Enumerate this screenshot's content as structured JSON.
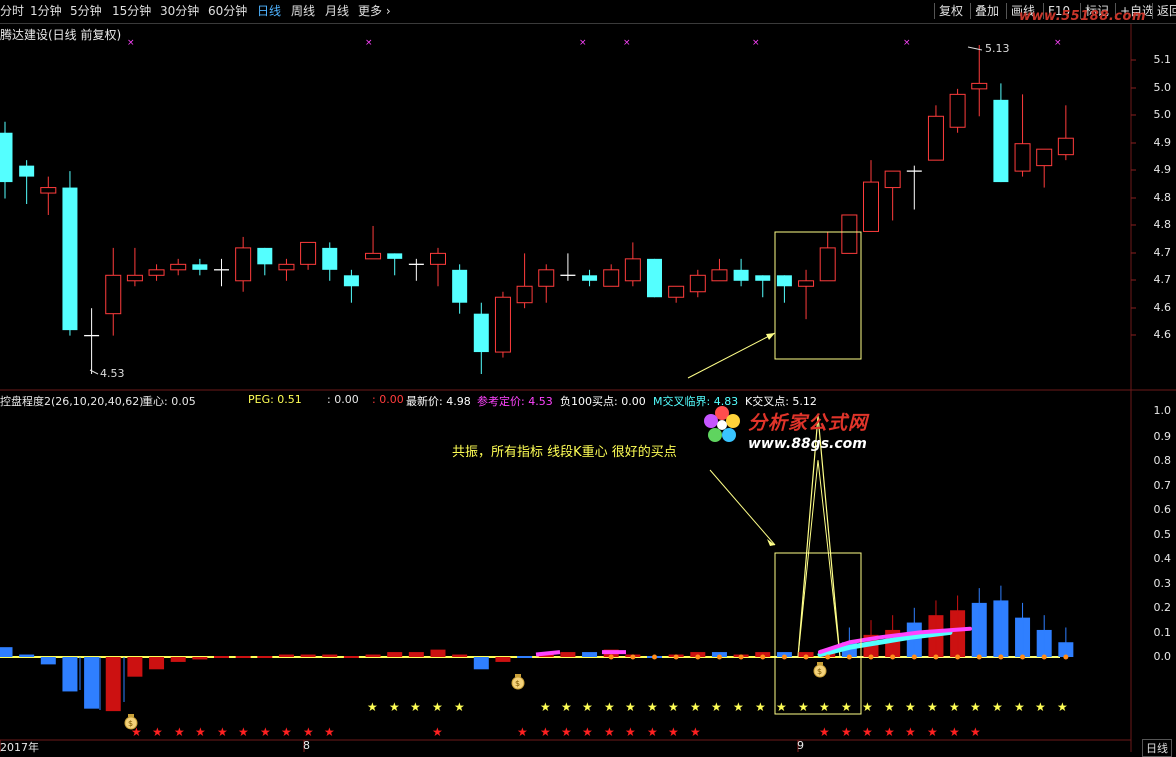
{
  "toolbar": {
    "tabs": [
      {
        "label": "分时",
        "x": 0
      },
      {
        "label": "1分钟",
        "x": 30
      },
      {
        "label": "5分钟",
        "x": 70
      },
      {
        "label": "15分钟",
        "x": 112
      },
      {
        "label": "30分钟",
        "x": 160
      },
      {
        "label": "60分钟",
        "x": 208
      },
      {
        "label": "日线",
        "x": 257,
        "active": true
      },
      {
        "label": "周线",
        "x": 291
      },
      {
        "label": "月线",
        "x": 325
      },
      {
        "label": "更多 ›",
        "x": 358
      }
    ],
    "right": [
      {
        "label": "复权",
        "x": 934
      },
      {
        "label": "叠加",
        "x": 970
      },
      {
        "label": "画线",
        "x": 1006
      },
      {
        "label": "F10",
        "x": 1043
      },
      {
        "label": "标记",
        "x": 1080
      },
      {
        "label": "+自选",
        "x": 1115
      },
      {
        "label": "返回",
        "x": 1152
      }
    ],
    "watermark": "www.55188.com"
  },
  "stock_title": "腾达建设(日线 前复权)",
  "price_axis": [
    "5.1",
    "5.0",
    "5.0",
    "4.9",
    "4.9",
    "4.8",
    "4.8",
    "4.7",
    "4.7",
    "4.6",
    "4.6"
  ],
  "max_label": "5.13",
  "min_label": "4.53",
  "indicator": {
    "name": "控盘程度2(26,10,20,40,62)",
    "zhongxin": "重心: 0.05",
    "peg": "PEG: 0.51",
    "blank": ": 0.00",
    "red": ": 0.00",
    "zuixin": "最新价: 4.98",
    "cankao": "参考定价: 4.53",
    "fu100": "负100买点: 0.00",
    "mjiao": "M交叉临界: 4.83",
    "kjiao": "K交叉点: 5.12",
    "axis": [
      "1.0",
      "0.9",
      "0.8",
      "0.7",
      "0.6",
      "0.5",
      "0.4",
      "0.3",
      "0.2",
      "0.1",
      "0.0"
    ]
  },
  "annotation": "共振，所有指标 线段K重心 很好的买点",
  "logo": {
    "text": "分析家公式网",
    "sub": "www.88gs.com"
  },
  "x_axis": [
    {
      "label": "2017年",
      "x": 0
    },
    {
      "label": "8",
      "x": 303
    },
    {
      "label": "9",
      "x": 797
    }
  ],
  "bottom_right": "日线",
  "colors": {
    "up": "#ff3c3c",
    "down": "#54ffff",
    "yellow": "#ffff55",
    "magenta": "#ff44ff"
  },
  "chart_data": {
    "type": "candlestick",
    "series": [
      {
        "o": 4.97,
        "h": 4.99,
        "l": 4.85,
        "c": 4.88
      },
      {
        "o": 4.91,
        "h": 4.92,
        "l": 4.84,
        "c": 4.89
      },
      {
        "o": 4.86,
        "h": 4.89,
        "l": 4.82,
        "c": 4.87
      },
      {
        "o": 4.87,
        "h": 4.9,
        "l": 4.6,
        "c": 4.61
      },
      {
        "o": 4.6,
        "h": 4.65,
        "l": 4.53,
        "c": 4.6
      },
      {
        "o": 4.64,
        "h": 4.76,
        "l": 4.6,
        "c": 4.71
      },
      {
        "o": 4.7,
        "h": 4.76,
        "l": 4.69,
        "c": 4.71
      },
      {
        "o": 4.71,
        "h": 4.73,
        "l": 4.7,
        "c": 4.72
      },
      {
        "o": 4.72,
        "h": 4.74,
        "l": 4.71,
        "c": 4.73
      },
      {
        "o": 4.73,
        "h": 4.74,
        "l": 4.71,
        "c": 4.72
      },
      {
        "o": 4.72,
        "h": 4.74,
        "l": 4.69,
        "c": 4.72
      },
      {
        "o": 4.7,
        "h": 4.78,
        "l": 4.68,
        "c": 4.76
      },
      {
        "o": 4.76,
        "h": 4.76,
        "l": 4.71,
        "c": 4.73
      },
      {
        "o": 4.72,
        "h": 4.74,
        "l": 4.7,
        "c": 4.73
      },
      {
        "o": 4.73,
        "h": 4.77,
        "l": 4.72,
        "c": 4.77
      },
      {
        "o": 4.76,
        "h": 4.77,
        "l": 4.7,
        "c": 4.72
      },
      {
        "o": 4.71,
        "h": 4.72,
        "l": 4.66,
        "c": 4.69
      },
      {
        "o": 4.74,
        "h": 4.8,
        "l": 4.74,
        "c": 4.75
      },
      {
        "o": 4.75,
        "h": 4.75,
        "l": 4.71,
        "c": 4.74
      },
      {
        "o": 4.73,
        "h": 4.74,
        "l": 4.7,
        "c": 4.73
      },
      {
        "o": 4.73,
        "h": 4.76,
        "l": 4.69,
        "c": 4.75
      },
      {
        "o": 4.72,
        "h": 4.73,
        "l": 4.64,
        "c": 4.66
      },
      {
        "o": 4.64,
        "h": 4.66,
        "l": 4.53,
        "c": 4.57
      },
      {
        "o": 4.57,
        "h": 4.68,
        "l": 4.56,
        "c": 4.67
      },
      {
        "o": 4.66,
        "h": 4.75,
        "l": 4.65,
        "c": 4.69
      },
      {
        "o": 4.69,
        "h": 4.73,
        "l": 4.66,
        "c": 4.72
      },
      {
        "o": 4.71,
        "h": 4.75,
        "l": 4.7,
        "c": 4.71
      },
      {
        "o": 4.71,
        "h": 4.72,
        "l": 4.69,
        "c": 4.7
      },
      {
        "o": 4.69,
        "h": 4.73,
        "l": 4.69,
        "c": 4.72
      },
      {
        "o": 4.7,
        "h": 4.77,
        "l": 4.69,
        "c": 4.74
      },
      {
        "o": 4.74,
        "h": 4.74,
        "l": 4.67,
        "c": 4.67
      },
      {
        "o": 4.67,
        "h": 4.69,
        "l": 4.66,
        "c": 4.69
      },
      {
        "o": 4.68,
        "h": 4.72,
        "l": 4.67,
        "c": 4.71
      },
      {
        "o": 4.7,
        "h": 4.74,
        "l": 4.7,
        "c": 4.72
      },
      {
        "o": 4.72,
        "h": 4.74,
        "l": 4.69,
        "c": 4.7
      },
      {
        "o": 4.71,
        "h": 4.71,
        "l": 4.67,
        "c": 4.7
      },
      {
        "o": 4.71,
        "h": 4.71,
        "l": 4.66,
        "c": 4.69
      },
      {
        "o": 4.69,
        "h": 4.72,
        "l": 4.63,
        "c": 4.7
      },
      {
        "o": 4.7,
        "h": 4.79,
        "l": 4.7,
        "c": 4.76
      },
      {
        "o": 4.75,
        "h": 4.82,
        "l": 4.75,
        "c": 4.82
      },
      {
        "o": 4.79,
        "h": 4.92,
        "l": 4.79,
        "c": 4.88
      },
      {
        "o": 4.87,
        "h": 4.9,
        "l": 4.81,
        "c": 4.9
      },
      {
        "o": 4.9,
        "h": 4.91,
        "l": 4.83,
        "c": 4.9
      },
      {
        "o": 4.92,
        "h": 5.02,
        "l": 4.92,
        "c": 5.0
      },
      {
        "o": 4.98,
        "h": 5.05,
        "l": 4.97,
        "c": 5.04
      },
      {
        "o": 5.05,
        "h": 5.13,
        "l": 5.0,
        "c": 5.06
      },
      {
        "o": 5.03,
        "h": 5.06,
        "l": 4.88,
        "c": 4.88
      },
      {
        "o": 4.9,
        "h": 5.04,
        "l": 4.89,
        "c": 4.95
      },
      {
        "o": 4.91,
        "h": 4.93,
        "l": 4.87,
        "c": 4.94
      },
      {
        "o": 4.93,
        "h": 5.02,
        "l": 4.92,
        "c": 4.96
      }
    ]
  }
}
